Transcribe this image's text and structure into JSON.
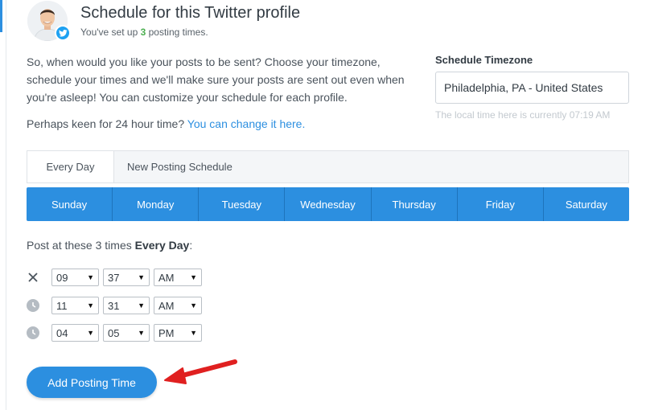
{
  "header": {
    "title": "Schedule for this Twitter profile",
    "subtitle_prefix": "You've set up",
    "posting_count": "3",
    "subtitle_suffix": "posting times."
  },
  "intro": {
    "text": "So, when would you like your posts to be sent? Choose your timezone, schedule your times and we'll make sure your posts are sent out even when you're asleep! You can customize your schedule for each profile.",
    "keen_text": "Perhaps keen for 24 hour time?",
    "keen_link": "You can change it here."
  },
  "timezone": {
    "label": "Schedule Timezone",
    "value": "Philadelphia, PA - United States",
    "hint": "The local time here is currently 07:19 AM"
  },
  "tabs": [
    {
      "label": "Every Day",
      "active": true
    },
    {
      "label": "New Posting Schedule",
      "active": false
    }
  ],
  "days": [
    "Sunday",
    "Monday",
    "Tuesday",
    "Wednesday",
    "Thursday",
    "Friday",
    "Saturday"
  ],
  "post_times": {
    "label_prefix": "Post at these 3 times",
    "label_bold": "Every Day",
    "label_suffix": ":",
    "rows": [
      {
        "icon": "close-icon",
        "hour": "09",
        "minute": "37",
        "ampm": "AM"
      },
      {
        "icon": "clock-icon",
        "hour": "11",
        "minute": "31",
        "ampm": "AM"
      },
      {
        "icon": "clock-icon",
        "hour": "04",
        "minute": "05",
        "ampm": "PM"
      }
    ]
  },
  "add_button": {
    "label": "Add Posting Time"
  },
  "colors": {
    "accent": "#2c8fe0",
    "count_green": "#4caf50",
    "twitter": "#1da1f2",
    "annotation_red": "#e02020"
  }
}
